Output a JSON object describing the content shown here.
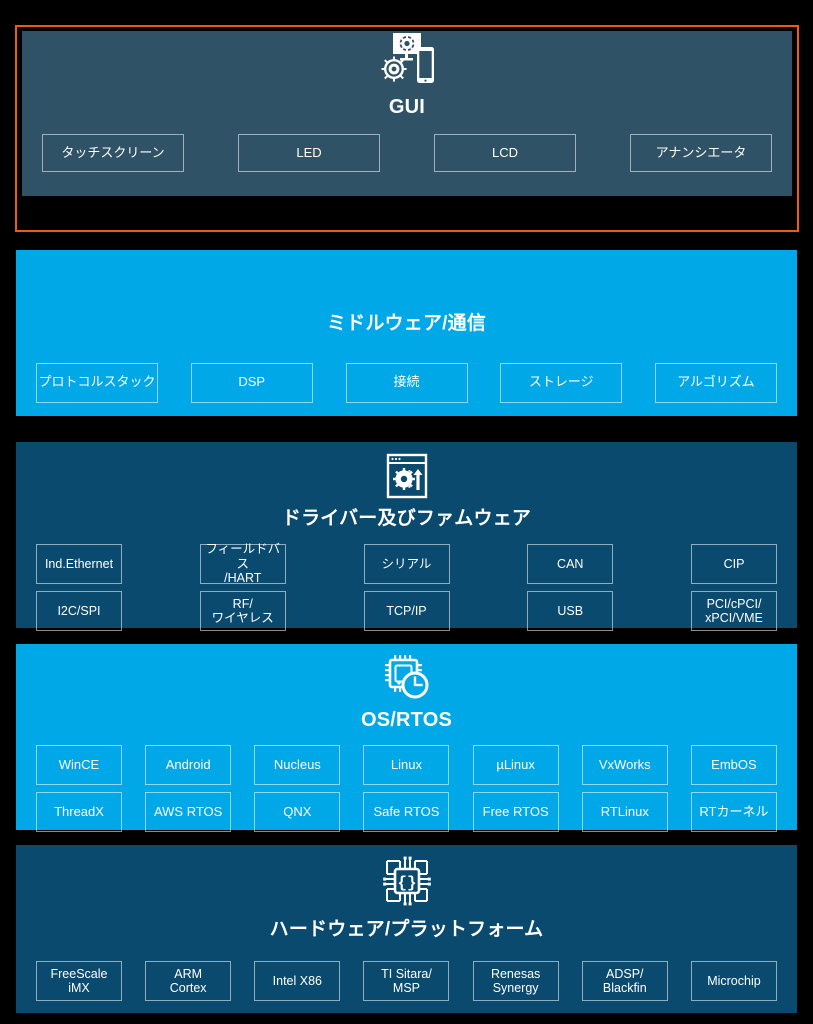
{
  "diagram": {
    "title": "Embedded Software Stack",
    "highlight_color": "#EA5B14",
    "background": "#000000",
    "layers": [
      {
        "id": "gui",
        "title": "GUI",
        "icon": "monitor-gear-tablet-icon",
        "color": "#2F5266",
        "highlighted": true,
        "items": [
          "タッチスクリーン",
          "LED",
          "LCD",
          "アナンシエータ"
        ]
      },
      {
        "id": "middleware",
        "title": "ミドルウェア/通信",
        "icon": "none",
        "color": "#00A8E8",
        "highlighted": false,
        "items": [
          "プロトコルスタック",
          "DSP",
          "接続",
          "ストレージ",
          "アルゴリズム"
        ]
      },
      {
        "id": "drivers",
        "title": "ドライバー及びファムウェア",
        "icon": "window-gear-arrow-icon",
        "color": "#0B4A6F",
        "highlighted": false,
        "columns": [
          {
            "top": "Ind.Ethernet",
            "bottom": "I2C/SPI"
          },
          {
            "top": "フィールドバス\n/HART",
            "bottom": "RF/\nワイヤレス"
          },
          {
            "top": "シリアル",
            "bottom": "TCP/IP"
          },
          {
            "top": "CAN",
            "bottom": "USB"
          },
          {
            "top": "CIP",
            "bottom": "PCI/cPCI/\nxPCI/VME"
          }
        ]
      },
      {
        "id": "osrtos",
        "title": "OS/RTOS",
        "icon": "cpu-clock-icon",
        "color": "#00A8E8",
        "highlighted": false,
        "columns": [
          {
            "top": "WinCE",
            "bottom": "ThreadX"
          },
          {
            "top": "Android",
            "bottom": "AWS RTOS"
          },
          {
            "top": "Nucleus",
            "bottom": "QNX"
          },
          {
            "top": "Linux",
            "bottom": "Safe RTOS"
          },
          {
            "top": "µLinux",
            "bottom": "Free RTOS"
          },
          {
            "top": "VxWorks",
            "bottom": "RTLinux"
          },
          {
            "top": "EmbOS",
            "bottom": "RTカーネル"
          }
        ]
      },
      {
        "id": "hardware",
        "title": "ハードウェア/プラットフォーム",
        "icon": "microchip-braces-icon",
        "color": "#0B4A6F",
        "highlighted": false,
        "items": [
          "FreeScale\niMX",
          "ARM\nCortex",
          "Intel X86",
          "TI Sitara/\nMSP",
          "Renesas\nSynergy",
          "ADSP/\nBlackfin",
          "Microchip"
        ]
      }
    ]
  }
}
